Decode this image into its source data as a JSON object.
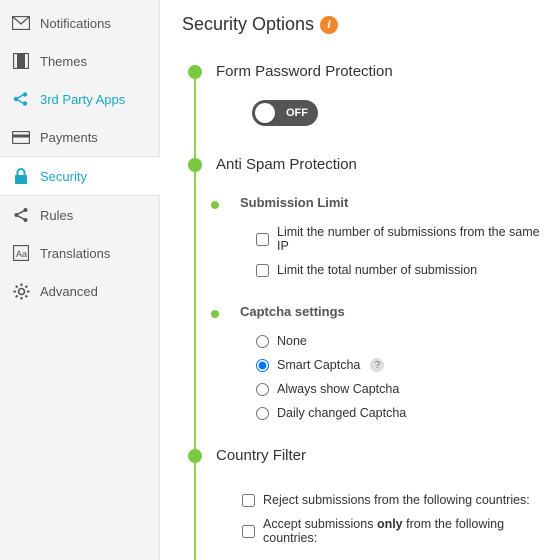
{
  "sidebar": {
    "items": [
      {
        "label": "Notifications"
      },
      {
        "label": "Themes"
      },
      {
        "label": "3rd Party Apps"
      },
      {
        "label": "Payments"
      },
      {
        "label": "Security"
      },
      {
        "label": "Rules"
      },
      {
        "label": "Translations"
      },
      {
        "label": "Advanced"
      }
    ]
  },
  "header": {
    "title": "Security Options"
  },
  "sections": {
    "form_password": {
      "title": "Form Password Protection",
      "toggle_label": "OFF"
    },
    "anti_spam": {
      "title": "Anti Spam Protection"
    },
    "submission_limit": {
      "title": "Submission Limit",
      "opts": [
        "Limit the number of submissions from the same IP",
        "Limit the total number of submission"
      ]
    },
    "captcha": {
      "title": "Captcha settings",
      "opts": [
        "None",
        "Smart Captcha",
        "Always show Captcha",
        "Daily changed Captcha"
      ]
    },
    "country_filter": {
      "title": "Country Filter",
      "opts_pre": [
        "Reject submissions from the following countries:"
      ],
      "accept_prefix": "Accept submissions ",
      "accept_bold": "only",
      "accept_suffix": " from the following countries:"
    }
  }
}
